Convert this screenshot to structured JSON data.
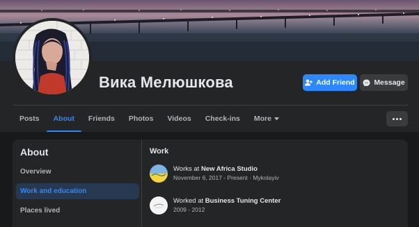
{
  "profile": {
    "name": "Вика Мелюшкова"
  },
  "actions": {
    "add_friend_label": "Add Friend",
    "message_label": "Message"
  },
  "tabs": [
    {
      "label": "Posts"
    },
    {
      "label": "About"
    },
    {
      "label": "Friends"
    },
    {
      "label": "Photos"
    },
    {
      "label": "Videos"
    },
    {
      "label": "Check-ins"
    },
    {
      "label": "More"
    }
  ],
  "about": {
    "title": "About",
    "nav": [
      {
        "label": "Overview"
      },
      {
        "label": "Work and education"
      },
      {
        "label": "Places lived"
      }
    ]
  },
  "work": {
    "title": "Work",
    "items": [
      {
        "prefix": "Works at ",
        "company": "New Africa Studio",
        "meta": "November 6, 2017 - Present · Mykolayiv"
      },
      {
        "prefix": "Worked at ",
        "company": "Business Tuning Center",
        "meta": "2009 - 2012"
      }
    ]
  },
  "colors": {
    "accent": "#2d88ff",
    "background": "#18191a",
    "surface": "#242526",
    "button_secondary": "#3a3b3c",
    "text_primary": "#e4e6eb",
    "text_secondary": "#b0b3b8"
  },
  "icons": {
    "add_friend": "person-plus-icon",
    "message": "messenger-icon",
    "more_tab": "caret-down-icon",
    "options": "more-dots-icon"
  }
}
